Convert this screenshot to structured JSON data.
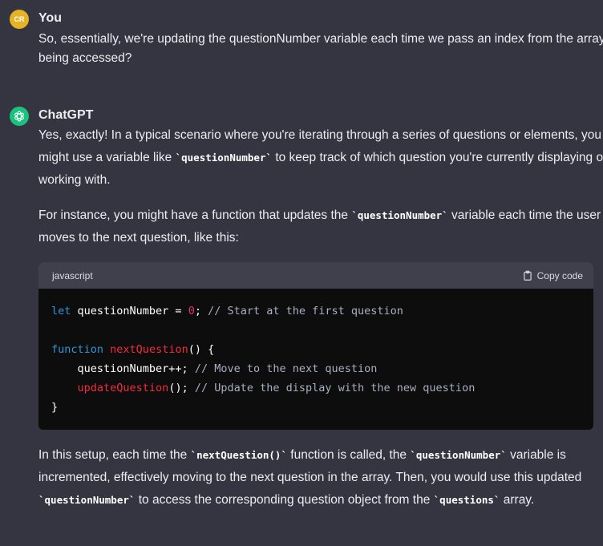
{
  "user_message": {
    "avatar_initials": "CR",
    "name": "You",
    "text": "So, essentially, we're updating the questionNumber variable each time we pass an index from the array being accessed?"
  },
  "assistant_message": {
    "name": "ChatGPT",
    "para1_a": "Yes, exactly! In a typical scenario where you're iterating through a series of questions or elements, you might use a variable like ",
    "para1_code": "`questionNumber`",
    "para1_b": " to keep track of which question you're currently displaying or working with.",
    "para2_a": "For instance, you might have a function that updates the ",
    "para2_code": "`questionNumber`",
    "para2_b": " variable each time the user moves to the next question, like this:",
    "code_block": {
      "language": "javascript",
      "copy_label": "Copy code",
      "line1_kw": "let",
      "line1_var": " questionNumber = ",
      "line1_num": "0",
      "line1_semi": "; ",
      "line1_comment": "// Start at the first question",
      "line3_kw": "function",
      "line3_sp": " ",
      "line3_fn": "nextQuestion",
      "line3_rest": "() {",
      "line4_code": "    questionNumber++; ",
      "line4_comment": "// Move to the next question",
      "line5_indent": "    ",
      "line5_fn": "updateQuestion",
      "line5_rest": "(); ",
      "line5_comment": "// Update the display with the new question",
      "line6": "}"
    },
    "para3_a": "In this setup, each time the ",
    "para3_code1": "`nextQuestion()`",
    "para3_b": " function is called, the ",
    "para3_code2": "`questionNumber`",
    "para3_c": " variable is incremented, effectively moving to the next question in the array. Then, you would use this updated ",
    "para3_code3": "`questionNumber`",
    "para3_d": " to access the corresponding question object from the ",
    "para3_code4": "`questions`",
    "para3_e": " array."
  },
  "icons": {
    "user_avatar": "user-avatar-icon",
    "gpt_logo": "openai-logo-icon",
    "copy": "clipboard-icon"
  },
  "colors": {
    "background": "#343541",
    "code_bg": "#0d0d0d",
    "keyword": "#2e95d3",
    "function": "#f22c3d",
    "number": "#df3079",
    "comment": "#a9aec1",
    "user_avatar": "#e7b324",
    "gpt_avatar": "#19c37d"
  }
}
